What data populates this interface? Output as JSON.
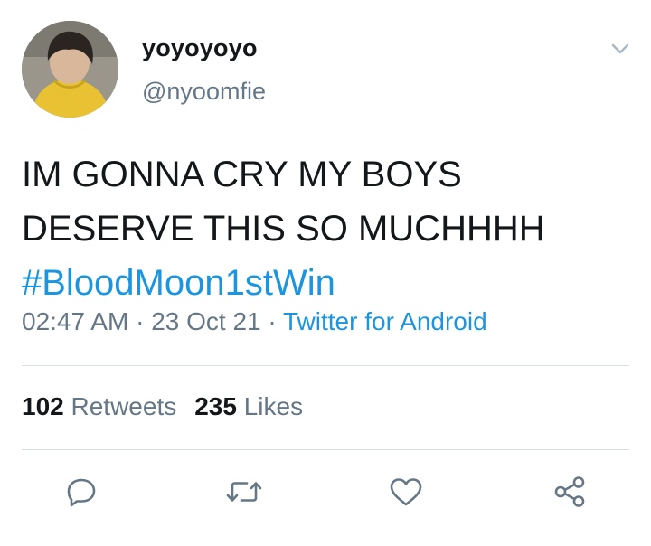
{
  "user": {
    "display_name": "yoyoyoyo",
    "handle": "@nyoomfie"
  },
  "tweet": {
    "text_lines": [
      "IM GONNA CRY MY BOYS",
      "DESERVE THIS SO MUCHHHH"
    ],
    "hashtag": "#BloodMoon1stWin"
  },
  "meta": {
    "time": "02:47 AM",
    "sep1": " · ",
    "date": "23 Oct 21",
    "sep2": " · ",
    "source": "Twitter for Android"
  },
  "stats": {
    "retweets_count": "102",
    "retweets_label": "Retweets",
    "likes_count": "235",
    "likes_label": "Likes"
  },
  "icons": {
    "caret": "chevron-down-icon",
    "reply": "reply-icon",
    "retweet": "retweet-icon",
    "like": "heart-icon",
    "share": "share-icon"
  },
  "colors": {
    "text": "#14171a",
    "secondary": "#657786",
    "link": "#1b95e0",
    "divider": "#d7dde2"
  }
}
